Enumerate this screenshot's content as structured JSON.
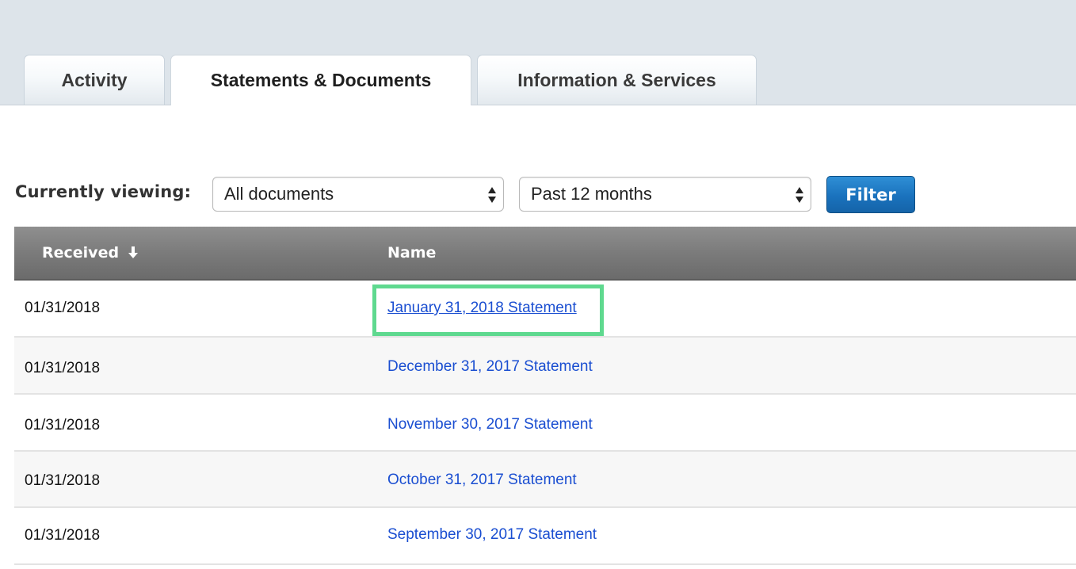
{
  "tabs": [
    {
      "label": "Activity",
      "active": false
    },
    {
      "label": "Statements & Documents",
      "active": true
    },
    {
      "label": "Information & Services",
      "active": false
    }
  ],
  "filter_bar": {
    "label": "Currently viewing:",
    "document_type": "All documents",
    "period": "Past 12 months",
    "filter_button": "Filter"
  },
  "table": {
    "columns": [
      "Received",
      "Name"
    ],
    "sort_icon": "down-arrow-icon",
    "rows": [
      {
        "received": "01/31/2018",
        "name": "January 31, 2018 Statement"
      },
      {
        "received": "01/31/2018",
        "name": "December 31, 2017 Statement"
      },
      {
        "received": "01/31/2018",
        "name": "November 30, 2017 Statement"
      },
      {
        "received": "01/31/2018",
        "name": "October 31, 2017 Statement"
      },
      {
        "received": "01/31/2018",
        "name": "September 30, 2017 Statement"
      }
    ]
  },
  "colors": {
    "link": "#1a4ed1",
    "highlight": "#5fd98f",
    "filter_button": "#1a72bd",
    "header": "#7b7b7b"
  }
}
